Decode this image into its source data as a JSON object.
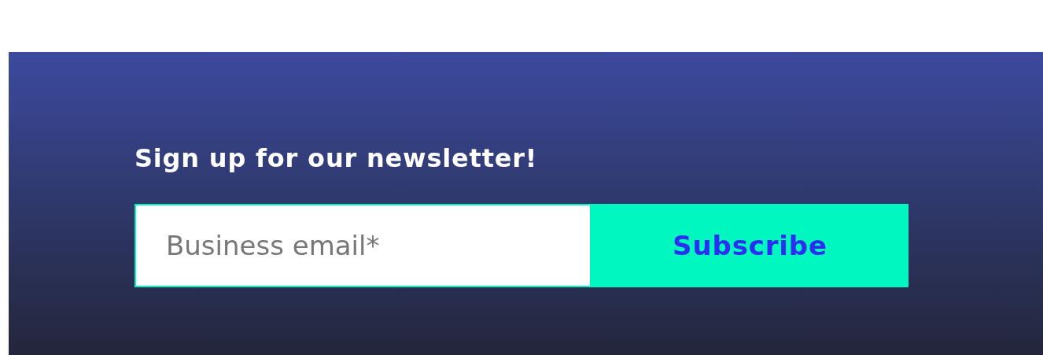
{
  "newsletter": {
    "heading": "Sign up for our newsletter!",
    "email_field": {
      "placeholder": "Business email*"
    },
    "button": "Subscribe"
  }
}
